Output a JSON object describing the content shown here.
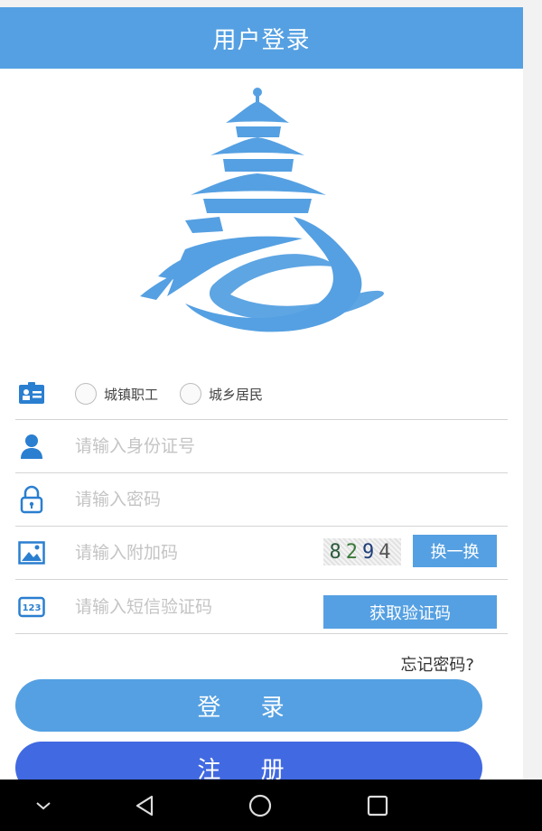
{
  "header": {
    "title": "用户登录"
  },
  "identity": {
    "options": [
      "城镇职工",
      "城乡居民"
    ]
  },
  "fields": {
    "id_placeholder": "请输入身份证号",
    "password_placeholder": "请输入密码",
    "captcha_placeholder": "请输入附加码",
    "sms_placeholder": "请输入短信验证码"
  },
  "captcha": {
    "digits": [
      "8",
      "2",
      "9",
      "4"
    ],
    "refresh_label": "换一换"
  },
  "sms": {
    "get_code_label": "获取验证码"
  },
  "forgot_label": "忘记密码?",
  "buttons": {
    "login_label": "登 录",
    "register_label": "注 册"
  },
  "colors": {
    "primary": "#55a0e2",
    "register": "#4169e1",
    "icon": "#2a7fd0"
  },
  "navbar": {
    "icons": [
      "chevron-down-icon",
      "back-triangle-icon",
      "home-circle-icon",
      "recent-square-icon"
    ]
  }
}
